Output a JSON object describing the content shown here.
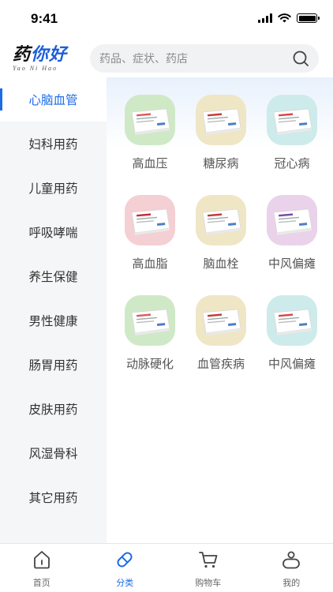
{
  "status_bar": {
    "time": "9:41"
  },
  "header": {
    "logo_text_a": "药",
    "logo_text_b": "你好",
    "logo_sub": "Yao Ni Hao",
    "search_placeholder": "药品、症状、药店"
  },
  "sidebar": {
    "items": [
      {
        "label": "心脑血管",
        "active": true
      },
      {
        "label": "妇科用药"
      },
      {
        "label": "儿童用药"
      },
      {
        "label": "呼吸哮喘"
      },
      {
        "label": "养生保健"
      },
      {
        "label": "男性健康"
      },
      {
        "label": "肠胃用药"
      },
      {
        "label": "皮肤用药"
      },
      {
        "label": "风湿骨科"
      },
      {
        "label": "其它用药"
      }
    ]
  },
  "grid": {
    "items": [
      {
        "label": "高血压",
        "tile": "green",
        "icon": "medicine-box-icon"
      },
      {
        "label": "糖尿病",
        "tile": "tan",
        "icon": "medicine-box-icon"
      },
      {
        "label": "冠心病",
        "tile": "teal",
        "icon": "medicine-box-icon"
      },
      {
        "label": "高血脂",
        "tile": "pink",
        "icon": "medicine-box-icon"
      },
      {
        "label": "脑血栓",
        "tile": "tan",
        "icon": "medicine-box-icon"
      },
      {
        "label": "中风偏瘫",
        "tile": "violet",
        "icon": "medicine-box-icon"
      },
      {
        "label": "动脉硬化",
        "tile": "green",
        "icon": "medicine-box-icon"
      },
      {
        "label": "血管疾病",
        "tile": "tan",
        "icon": "medicine-box-icon"
      },
      {
        "label": "中风偏瘫",
        "tile": "teal",
        "icon": "medicine-box-icon"
      }
    ]
  },
  "tabbar": {
    "items": [
      {
        "label": "首页",
        "icon": "home-icon"
      },
      {
        "label": "分类",
        "icon": "pill-icon",
        "active": true
      },
      {
        "label": "购物车",
        "icon": "cart-icon"
      },
      {
        "label": "我的",
        "icon": "user-icon"
      }
    ]
  },
  "colors": {
    "accent": "#1e6be6",
    "sidebar_bg": "#f5f6f7"
  }
}
